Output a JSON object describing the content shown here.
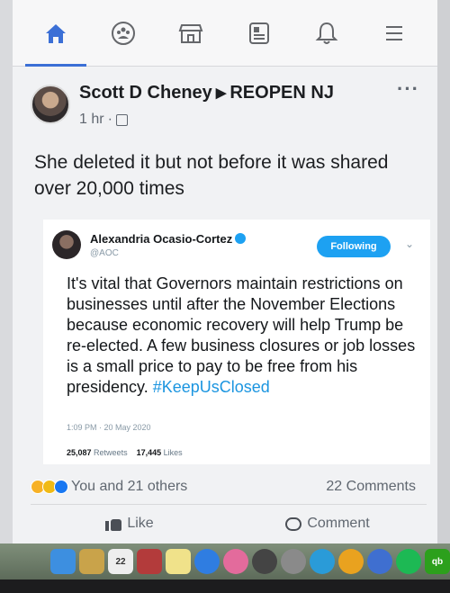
{
  "post": {
    "author": "Scott D Cheney",
    "group": "REOPEN NJ",
    "time": "1 hr",
    "more": "···",
    "text": "She deleted it but not before it was shared over 20,000 times"
  },
  "tweet": {
    "name": "Alexandria Ocasio-Cortez",
    "handle": "@AOC",
    "follow_label": "Following",
    "chevron": "⌄",
    "body": "It's vital that Governors maintain restrictions on businesses until after the November Elections because economic recovery will help Trump be re-elected. A few business closures or job losses is a small price to pay to be free from his presidency. ",
    "hashtag": "#KeepUsClosed",
    "timestamp": "1:09 PM · 20 May 2020",
    "retweets": "25,087",
    "retweets_label": "Retweets",
    "likes": "17,445",
    "likes_label": "Likes"
  },
  "reactions": {
    "text": "You and 21 others",
    "comments": "22 Comments"
  },
  "actions": {
    "like": "Like",
    "comment": "Comment"
  },
  "dock": {
    "calendar_day": "22",
    "qb_label": "qb"
  },
  "colors": {
    "facebook_blue": "#3b6fd6",
    "twitter_blue": "#1da1f2",
    "hashtag": "#1b95e0"
  }
}
